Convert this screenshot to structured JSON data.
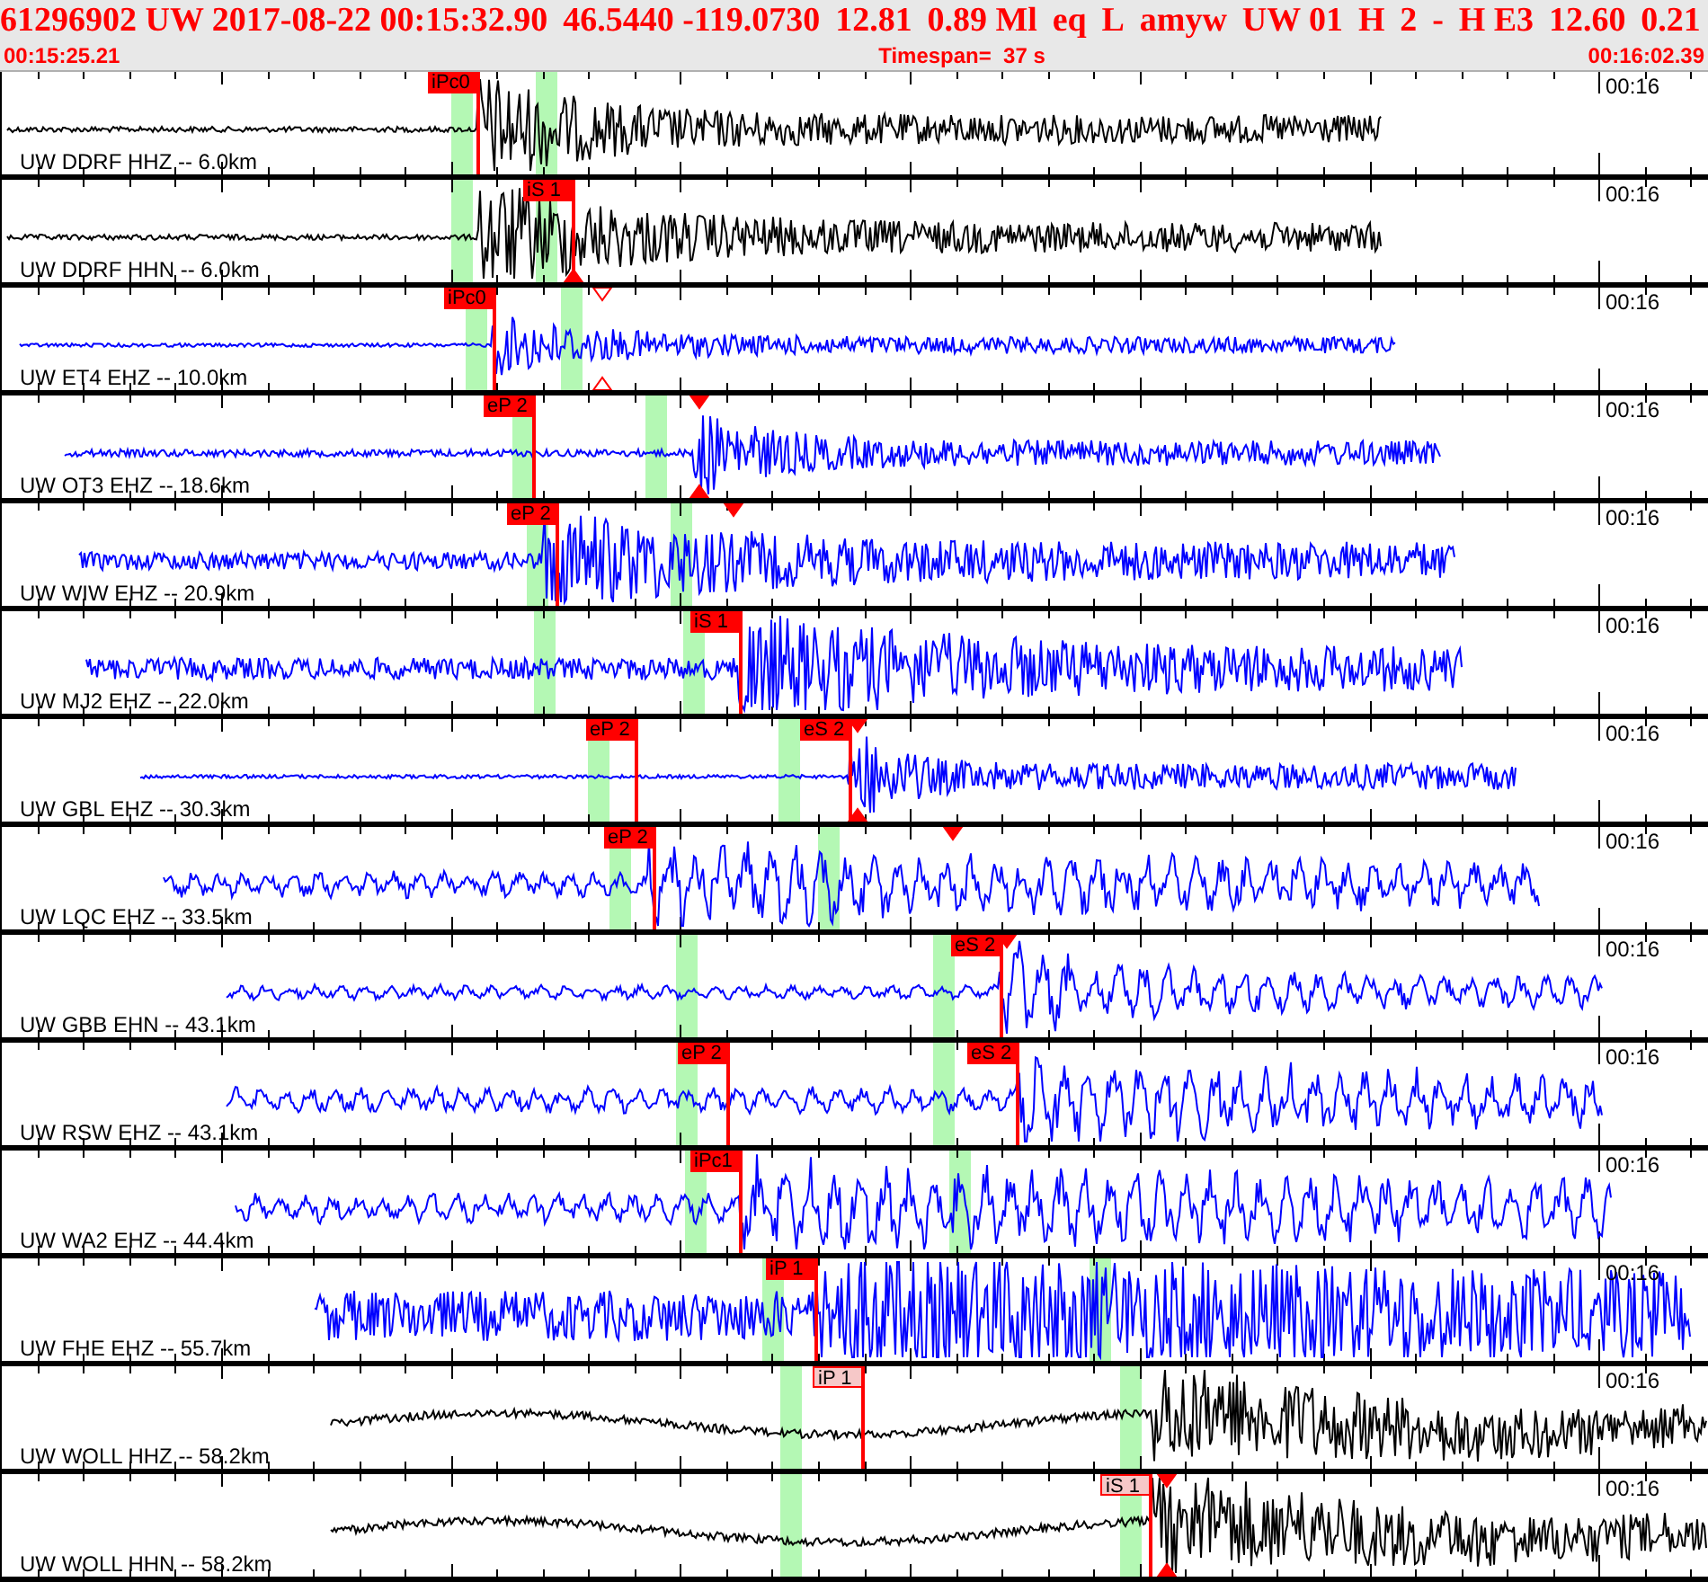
{
  "header": {
    "fields": [
      "61296902 UW 2017-08-22 00:15:32.90",
      "46.5440 -119.0730",
      "12.81",
      "0.89 Ml",
      "eq",
      "L",
      "amyw",
      "UW 01",
      "H",
      "2",
      "-",
      "H E3",
      "12.60",
      "0.21"
    ],
    "start_time": "00:15:25.21",
    "timespan": "Timespan=  37 s",
    "end_time": "00:16:02.39"
  },
  "traces": [
    {
      "label": "UW DDRF HHZ -- 6.0km",
      "time_label": "00:16",
      "color": "#000000",
      "picks": [
        {
          "label": "iPc0",
          "kind": "solid"
        }
      ]
    },
    {
      "label": "UW DDRF HHN -- 6.0km",
      "time_label": "00:16",
      "color": "#000000",
      "picks": [
        {
          "label": "iS 1",
          "kind": "solid"
        }
      ]
    },
    {
      "label": "UW ET4 EHZ -- 10.0km",
      "time_label": "00:16",
      "color": "#0000ff",
      "picks": [
        {
          "label": "iPc0",
          "kind": "solid"
        }
      ]
    },
    {
      "label": "UW OT3 EHZ -- 18.6km",
      "time_label": "00:16",
      "color": "#0000ff",
      "picks": [
        {
          "label": "eP 2",
          "kind": "solid"
        }
      ]
    },
    {
      "label": "UW WIW EHZ -- 20.9km",
      "time_label": "00:16",
      "color": "#0000ff",
      "picks": [
        {
          "label": "eP 2",
          "kind": "solid"
        }
      ]
    },
    {
      "label": "UW MJ2 EHZ -- 22.0km",
      "time_label": "00:16",
      "color": "#0000ff",
      "picks": [
        {
          "label": "iS 1",
          "kind": "solid"
        }
      ]
    },
    {
      "label": "UW GBL EHZ -- 30.3km",
      "time_label": "00:16",
      "color": "#0000ff",
      "picks": [
        {
          "label": "eP 2",
          "kind": "solid"
        },
        {
          "label": "eS 2",
          "kind": "solid"
        }
      ]
    },
    {
      "label": "UW LQC EHZ -- 33.5km",
      "time_label": "00:16",
      "color": "#0000ff",
      "picks": [
        {
          "label": "eP 2",
          "kind": "solid"
        }
      ]
    },
    {
      "label": "UW GBB EHN -- 43.1km",
      "time_label": "00:16",
      "color": "#0000ff",
      "picks": [
        {
          "label": "eS 2",
          "kind": "solid"
        }
      ]
    },
    {
      "label": "UW RSW EHZ -- 43.1km",
      "time_label": "00:16",
      "color": "#0000ff",
      "picks": [
        {
          "label": "eP 2",
          "kind": "solid"
        },
        {
          "label": "eS 2",
          "kind": "solid"
        }
      ]
    },
    {
      "label": "UW WA2 EHZ -- 44.4km",
      "time_label": "00:16",
      "color": "#0000ff",
      "picks": [
        {
          "label": "iPc1",
          "kind": "solid"
        }
      ]
    },
    {
      "label": "UW FHE EHZ -- 55.7km",
      "time_label": "00:16",
      "color": "#0000ff",
      "picks": [
        {
          "label": "iP 1",
          "kind": "solid"
        }
      ]
    },
    {
      "label": "UW WOLL HHZ -- 58.2km",
      "time_label": "00:16",
      "color": "#000000",
      "picks": [
        {
          "label": "iP 1",
          "kind": "faint"
        }
      ]
    },
    {
      "label": "UW WOLL HHN -- 58.2km",
      "time_label": "00:16",
      "color": "#000000",
      "picks": [
        {
          "label": "iS 1",
          "kind": "faint"
        }
      ]
    }
  ]
}
